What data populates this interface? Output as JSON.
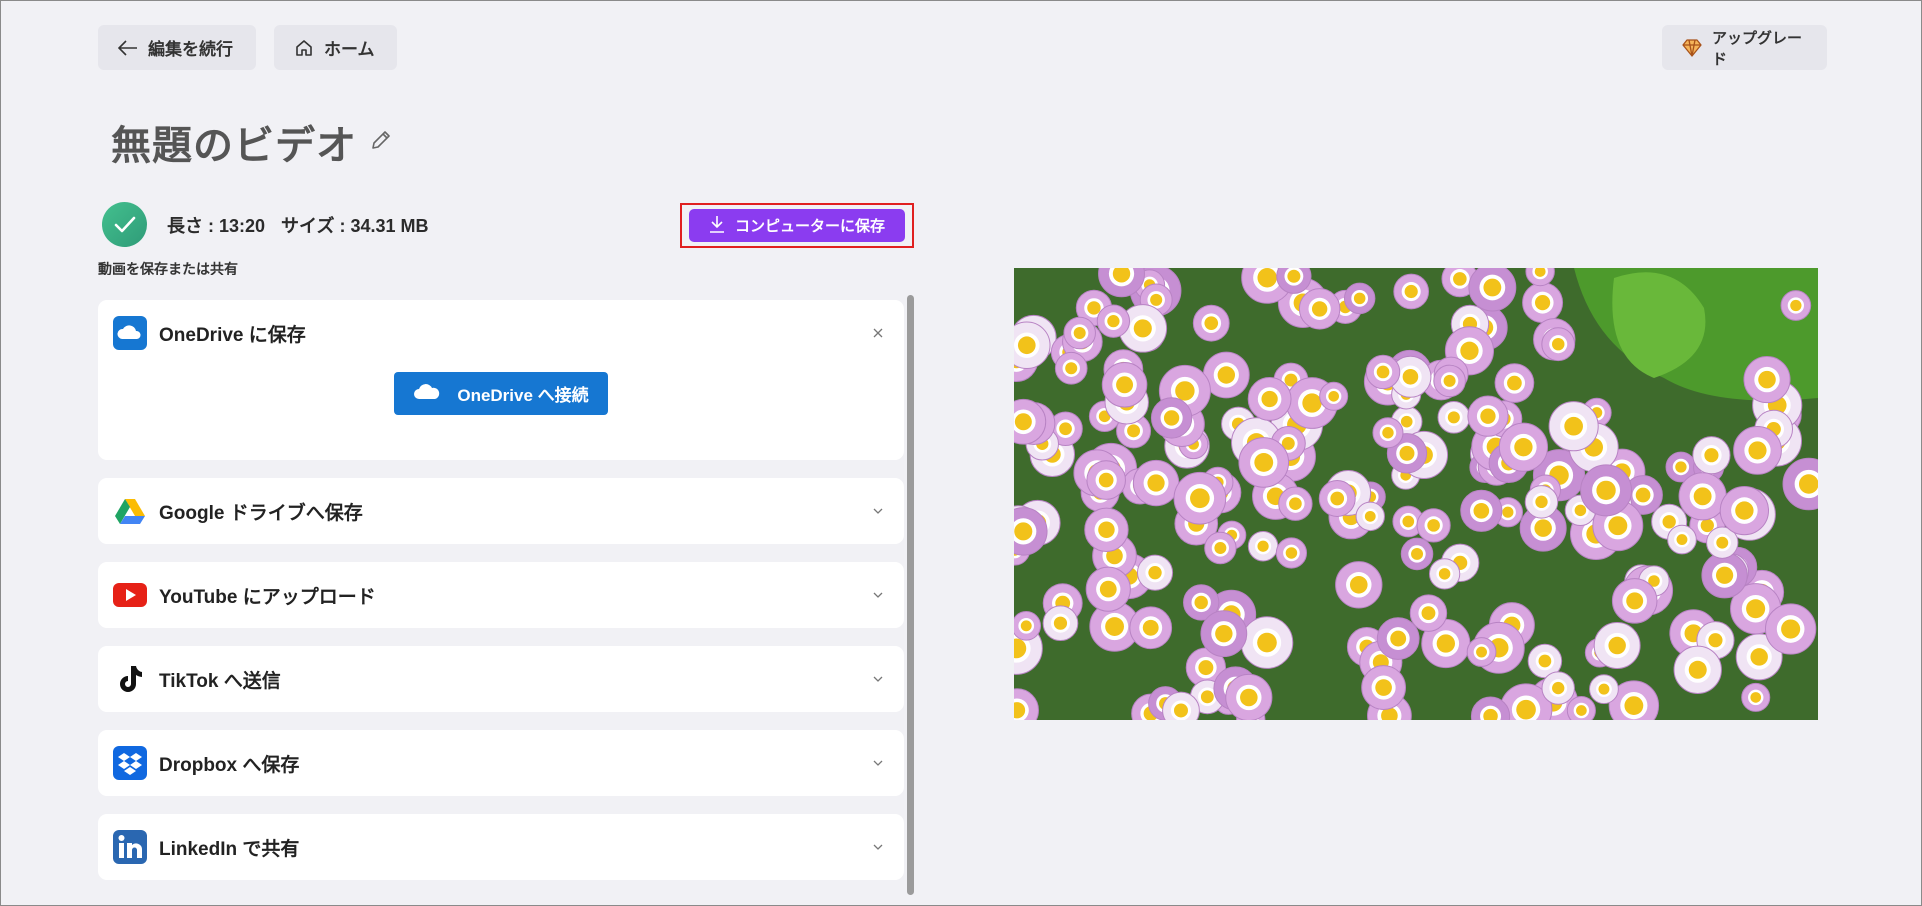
{
  "header": {
    "back_label": "編集を続行",
    "home_label": "ホーム",
    "upgrade_label": "アップグレード"
  },
  "video": {
    "title": "無題のビデオ",
    "length": "長さ : 13:20",
    "size": "サイズ : 34.31 MB"
  },
  "actions": {
    "save_computer_label": "コンピューターに保存",
    "section_label": "動画を保存または共有"
  },
  "share_options": [
    {
      "title": "OneDrive に保存",
      "expanded": true,
      "connect_label": "OneDrive へ接続",
      "icon": "onedrive-icon"
    },
    {
      "title": "Google ドライブへ保存",
      "expanded": false,
      "icon": "google-drive-icon"
    },
    {
      "title": "YouTube にアップロード",
      "expanded": false,
      "icon": "youtube-icon"
    },
    {
      "title": "TikTok へ送信",
      "expanded": false,
      "icon": "tiktok-icon"
    },
    {
      "title": "Dropbox へ保存",
      "expanded": false,
      "icon": "dropbox-icon"
    },
    {
      "title": "LinkedIn で共有",
      "expanded": false,
      "icon": "linkedin-icon"
    }
  ],
  "colors": {
    "accent_purple": "#8b3cf0",
    "onedrive_blue": "#1677d2",
    "highlight_red": "#e02020",
    "success_green": "#3bb085"
  }
}
